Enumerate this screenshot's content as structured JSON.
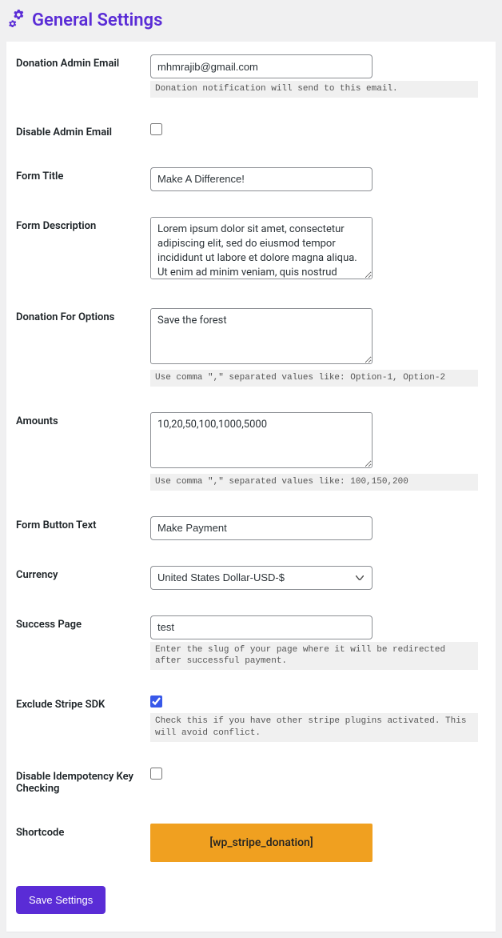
{
  "header": {
    "title": "General Settings"
  },
  "fields": {
    "donation_admin_email": {
      "label": "Donation Admin Email",
      "value": "mhmrajib@gmail.com",
      "hint": "Donation notification will send to this email."
    },
    "disable_admin_email": {
      "label": "Disable Admin Email",
      "checked": false
    },
    "form_title": {
      "label": "Form Title",
      "value": "Make A Difference!"
    },
    "form_description": {
      "label": "Form Description",
      "value": "Lorem ipsum dolor sit amet, consectetur adipiscing elit, sed do eiusmod tempor incididunt ut labore et dolore magna aliqua. Ut enim ad minim veniam, quis nostrud exercitation ullamco laboris nisi ut aliquip ex ea commodo"
    },
    "donation_for_options": {
      "label": "Donation For Options",
      "value": "Save the forest",
      "hint": "Use comma \",\" separated values like: Option-1, Option-2"
    },
    "amounts": {
      "label": "Amounts",
      "value": "10,20,50,100,1000,5000",
      "hint": "Use comma \",\" separated values like: 100,150,200"
    },
    "form_button_text": {
      "label": "Form Button Text",
      "value": "Make Payment"
    },
    "currency": {
      "label": "Currency",
      "value": "United States Dollar-USD-$"
    },
    "success_page": {
      "label": "Success Page",
      "value": "test",
      "hint": "Enter the slug of your page where it will be redirected after successful payment."
    },
    "exclude_stripe_sdk": {
      "label": "Exclude Stripe SDK",
      "checked": true,
      "hint": "Check this if you have other stripe plugins activated. This will avoid conflict."
    },
    "disable_idempotency": {
      "label": "Disable Idempotency Key Checking",
      "checked": false
    },
    "shortcode": {
      "label": "Shortcode",
      "value": "[wp_stripe_donation]"
    }
  },
  "actions": {
    "save_label": "Save Settings"
  }
}
